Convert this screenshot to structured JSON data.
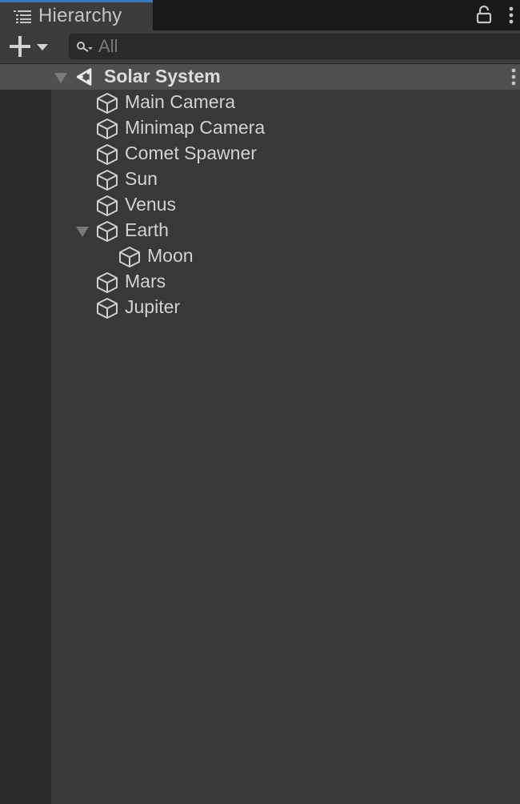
{
  "tab": {
    "title": "Hierarchy",
    "icon": "hierarchy-list-icon"
  },
  "toolbar": {
    "create_icon": "plus-icon",
    "search_placeholder": "All"
  },
  "scene": {
    "name": "Solar System",
    "icon": "unity-logo-icon",
    "expanded": true
  },
  "objects": [
    {
      "label": "Main Camera",
      "depth": 1
    },
    {
      "label": "Minimap Camera",
      "depth": 1
    },
    {
      "label": "Comet Spawner",
      "depth": 1
    },
    {
      "label": "Sun",
      "depth": 1
    },
    {
      "label": "Venus",
      "depth": 1
    },
    {
      "label": "Earth",
      "depth": 1,
      "expanded": true
    },
    {
      "label": "Moon",
      "depth": 2
    },
    {
      "label": "Mars",
      "depth": 1
    },
    {
      "label": "Jupiter",
      "depth": 1
    }
  ],
  "colors": {
    "background": "#383838",
    "gutter": "#2b2b2b",
    "tab_accent": "#3a79bb",
    "scene_row": "#4f4f4f",
    "text": "#d2d2d2"
  }
}
